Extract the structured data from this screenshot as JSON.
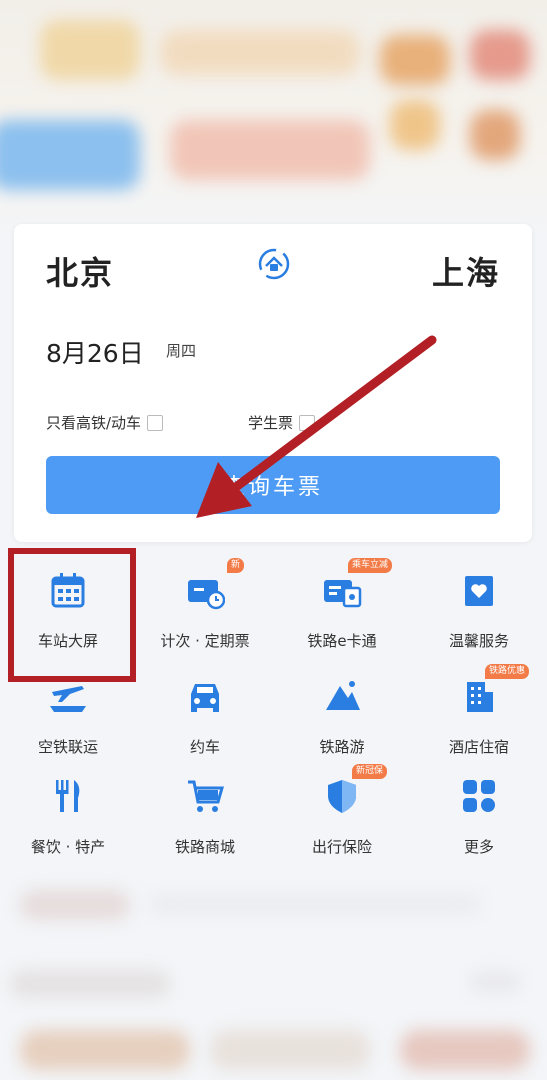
{
  "search": {
    "from_city": "北京",
    "to_city": "上海",
    "date": "8月26日",
    "weekday": "周四",
    "option_highspeed": "只看高铁/动车",
    "option_student": "学生票",
    "query_button": "查询车票"
  },
  "services": [
    {
      "label": "车站大屏",
      "icon": "calendar-icon",
      "badge": ""
    },
    {
      "label": "计次 · 定期票",
      "icon": "ticket-card-icon",
      "badge": "新"
    },
    {
      "label": "铁路e卡通",
      "icon": "e-card-icon",
      "badge": "乘车立减"
    },
    {
      "label": "温馨服务",
      "icon": "heart-service-icon",
      "badge": ""
    },
    {
      "label": "空铁联运",
      "icon": "plane-train-icon",
      "badge": ""
    },
    {
      "label": "约车",
      "icon": "car-icon",
      "badge": ""
    },
    {
      "label": "铁路游",
      "icon": "mountain-icon",
      "badge": ""
    },
    {
      "label": "酒店住宿",
      "icon": "hotel-icon",
      "badge": "铁路优惠"
    },
    {
      "label": "餐饮 · 特产",
      "icon": "fork-knife-icon",
      "badge": ""
    },
    {
      "label": "铁路商城",
      "icon": "cart-icon",
      "badge": ""
    },
    {
      "label": "出行保险",
      "icon": "shield-icon",
      "badge": "新冠保"
    },
    {
      "label": "更多",
      "icon": "more-grid-icon",
      "badge": ""
    }
  ],
  "colors": {
    "accent": "#4d9bf5",
    "icon_blue": "#2a7de1",
    "badge": "#f27b48",
    "annotation_red": "#b21f24"
  }
}
